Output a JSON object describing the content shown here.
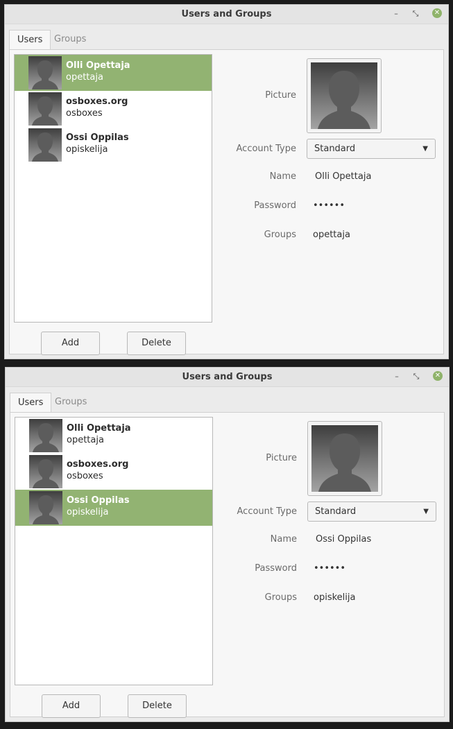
{
  "windows": [
    {
      "title": "Users and Groups",
      "tabs": [
        {
          "label": "Users",
          "active": true
        },
        {
          "label": "Groups",
          "active": false
        }
      ],
      "users": [
        {
          "name": "Olli Opettaja",
          "login": "opettaja",
          "selected": true
        },
        {
          "name": "osboxes.org",
          "login": "osboxes",
          "selected": false
        },
        {
          "name": "Ossi Oppilas",
          "login": "opiskelija",
          "selected": false
        }
      ],
      "buttons": {
        "add": "Add",
        "delete": "Delete"
      },
      "details": {
        "picture_label": "Picture",
        "account_type_label": "Account Type",
        "account_type_value": "Standard",
        "name_label": "Name",
        "name_value": "Olli Opettaja",
        "password_label": "Password",
        "password_value": "••••••",
        "groups_label": "Groups",
        "groups_value": "opettaja"
      },
      "icons": {
        "minimize": "minimize-icon",
        "restore": "restore-icon",
        "close": "close-icon"
      }
    },
    {
      "title": "Users and Groups",
      "tabs": [
        {
          "label": "Users",
          "active": true
        },
        {
          "label": "Groups",
          "active": false
        }
      ],
      "users": [
        {
          "name": "Olli Opettaja",
          "login": "opettaja",
          "selected": false
        },
        {
          "name": "osboxes.org",
          "login": "osboxes",
          "selected": false
        },
        {
          "name": "Ossi Oppilas",
          "login": "opiskelija",
          "selected": true
        }
      ],
      "buttons": {
        "add": "Add",
        "delete": "Delete"
      },
      "details": {
        "picture_label": "Picture",
        "account_type_label": "Account Type",
        "account_type_value": "Standard",
        "name_label": "Name",
        "name_value": "Ossi Oppilas",
        "password_label": "Password",
        "password_value": "••••••",
        "groups_label": "Groups",
        "groups_value": "opiskelija"
      },
      "icons": {
        "minimize": "minimize-icon",
        "restore": "restore-icon",
        "close": "close-icon"
      }
    }
  ],
  "colors": {
    "selection": "#92b372",
    "close_button": "#8fb36a"
  }
}
